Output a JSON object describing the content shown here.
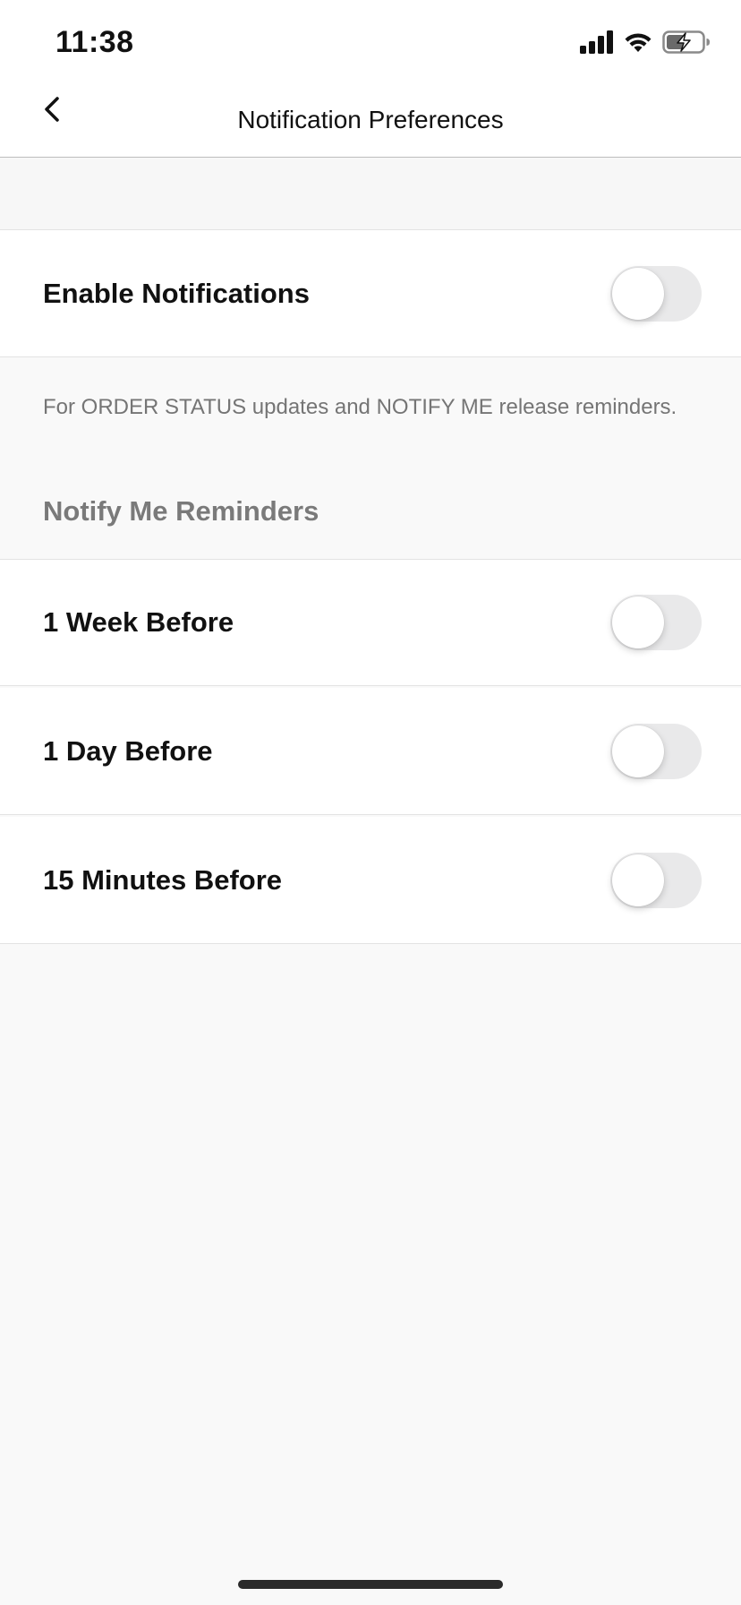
{
  "status_bar": {
    "time": "11:38",
    "icons": [
      "signal-icon",
      "wifi-icon",
      "battery-charging-icon"
    ]
  },
  "nav": {
    "title": "Notification Preferences",
    "back_icon": "chevron-left-icon"
  },
  "enable_notifications": {
    "label": "Enable Notifications",
    "on": false
  },
  "helper_text": "For ORDER STATUS updates and NOTIFY ME release reminders.",
  "reminders_section": {
    "header": "Notify Me Reminders",
    "items": [
      {
        "label": "1 Week Before",
        "on": false
      },
      {
        "label": "1 Day Before",
        "on": false
      },
      {
        "label": "15 Minutes Before",
        "on": false
      }
    ]
  },
  "colors": {
    "toggle_off_track": "#e9e9ea",
    "background": "#f9f9f9",
    "section_header": "#7a7a7a"
  }
}
